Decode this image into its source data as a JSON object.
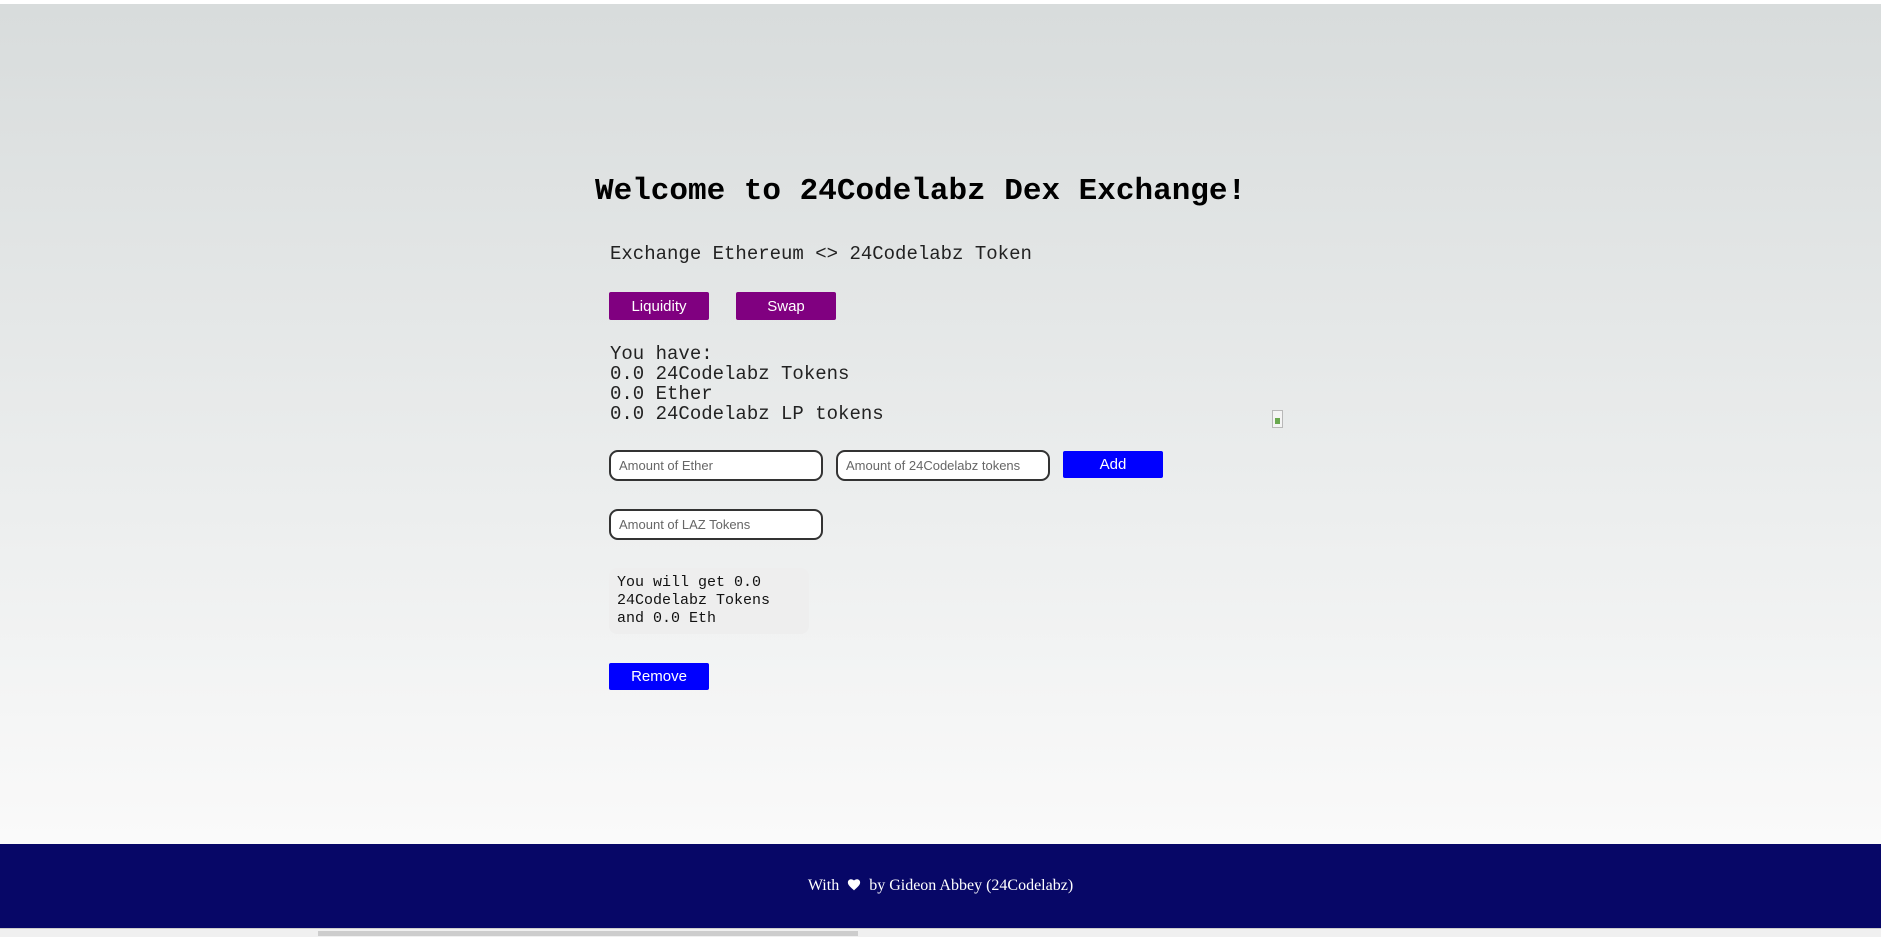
{
  "header": {
    "title": "Welcome to 24Codelabz Dex Exchange!",
    "subtitle": "Exchange Ethereum <> 24Codelabz Token"
  },
  "tabs": {
    "liquidity_label": "Liquidity",
    "swap_label": "Swap"
  },
  "balances": {
    "intro": "You have:",
    "token_line": "0.0 24Codelabz Tokens",
    "ether_line": "0.0 Ether",
    "lp_line": "0.0 24Codelabz LP tokens"
  },
  "add_liquidity": {
    "ether_placeholder": "Amount of Ether",
    "token_placeholder": "Amount of 24Codelabz tokens",
    "add_label": "Add"
  },
  "remove_liquidity": {
    "laz_placeholder": "Amount of LAZ Tokens",
    "result_text": "You will get 0.0 24Codelabz Tokens and 0.0 Eth",
    "remove_label": "Remove"
  },
  "footer": {
    "prefix": "With",
    "suffix": "by Gideon Abbey (24Codelabz)",
    "heart_icon": "heart-icon"
  },
  "colors": {
    "purple": "#800080",
    "blue": "#0000ff",
    "footer_bg": "#070767"
  }
}
